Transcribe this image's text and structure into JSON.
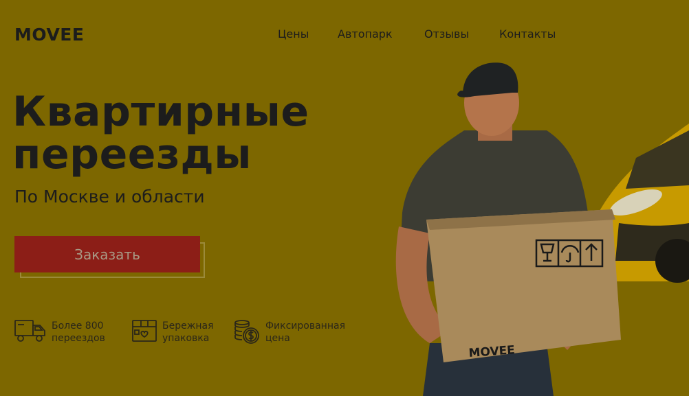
{
  "brand": {
    "logo": "MOVEE"
  },
  "nav": {
    "items": [
      "Цены",
      "Автопарк",
      "Отзывы",
      "Контакты"
    ]
  },
  "hero": {
    "title_line1": "Квартирные",
    "title_line2": "переезды",
    "subtitle": "По Москве и области",
    "cta_label": "Заказать"
  },
  "features": [
    {
      "icon": "truck-icon",
      "line1": "Более 800",
      "line2": "переездов"
    },
    {
      "icon": "package-icon",
      "line1": "Бережная",
      "line2": "упаковка"
    },
    {
      "icon": "coins-icon",
      "line1": "Фиксированная",
      "line2": "цена"
    }
  ],
  "box_label": "MOVEE",
  "colors": {
    "background": "#7d6700",
    "cta": "#8c1e17",
    "text": "#1c1c1c",
    "van": "#c79a00"
  }
}
